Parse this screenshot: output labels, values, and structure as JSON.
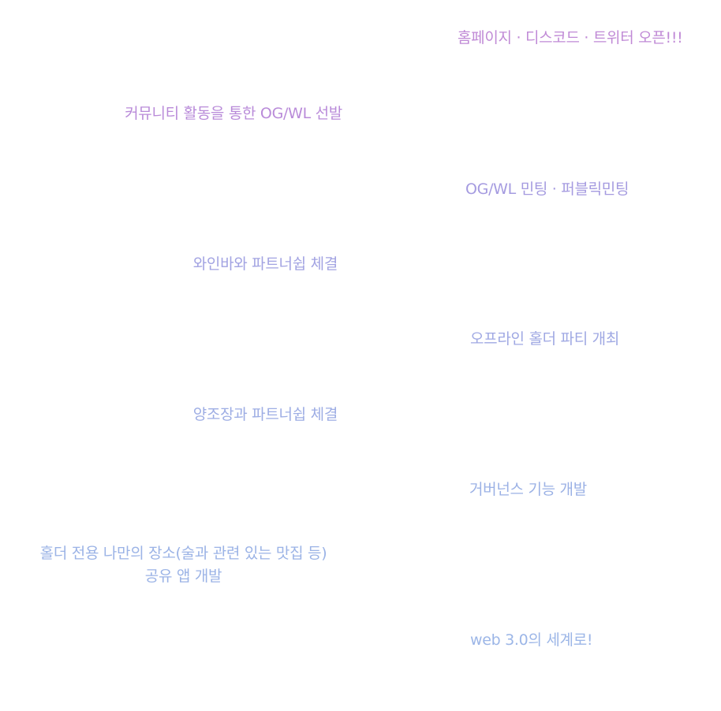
{
  "roadmap": {
    "items": [
      {
        "text": "홈페이지 · 디스코드 · 트위터 오픈!!!",
        "color": "#c08ad6"
      },
      {
        "text": "커뮤니티 활동을 통한 OG/WL 선발",
        "color": "#b98bd9"
      },
      {
        "text": "OG/WL 민팅 · 퍼블릭민팅",
        "color": "#a59be0"
      },
      {
        "text": "와인바와 파트너쉽 체결",
        "color": "#a2a3e2"
      },
      {
        "text": "오프라인 홀더 파티 개최",
        "color": "#9fa8e3"
      },
      {
        "text": "양조장과 파트너쉽 체결",
        "color": "#9dade4"
      },
      {
        "text": "거버넌스 기능 개발",
        "color": "#9bb1e5"
      },
      {
        "lines": [
          "홀더 전용 나만의 장소(술과 관련 있는 맛집 등)",
          "공유 앱 개발"
        ],
        "color": "#9bb3e6"
      },
      {
        "text": "web 3.0의 세계로!",
        "color": "#9cb6e7"
      }
    ]
  }
}
